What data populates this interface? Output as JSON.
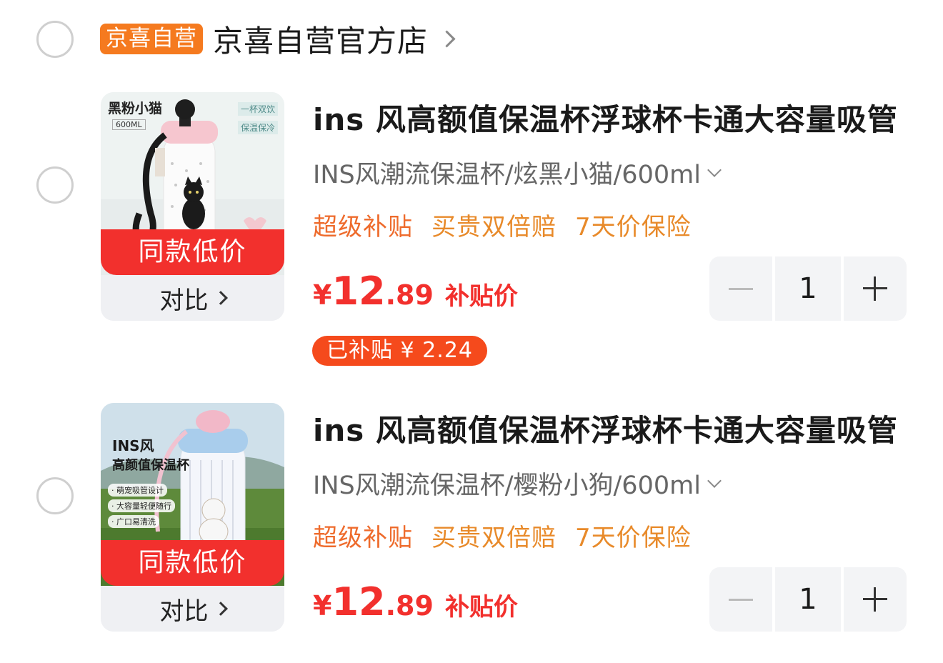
{
  "store": {
    "badge": "京喜自营",
    "name": "京喜自营官方店"
  },
  "items": [
    {
      "image_label": "黑粉小猫",
      "image_capacity": "600ML",
      "image_tag1": "一杯双饮",
      "image_tag2": "保温保冷",
      "same_price": "同款低价",
      "compare": "对比",
      "title": "ins 风高额值保温杯浮球杯卡通大容量吸管",
      "spec": "INS风潮流保温杯/炫黑小猫/600ml",
      "tags": [
        "超级补贴",
        "买贵双倍赔",
        "7天价保险"
      ],
      "price_currency": "¥",
      "price_int": "12",
      "price_dec": ".89",
      "price_label": "补贴价",
      "subsidy": "已补贴 ¥ 2.24",
      "qty": "1"
    },
    {
      "image_label": "INS风",
      "image_sub": "高颜值保温杯",
      "image_bullets": [
        "· 萌宠吸管设计",
        "· 大容量轻便随行",
        "· 广口易清洗"
      ],
      "same_price": "同款低价",
      "compare": "对比",
      "title": "ins 风高额值保温杯浮球杯卡通大容量吸管",
      "spec": "INS风潮流保温杯/樱粉小狗/600ml",
      "tags": [
        "超级补贴",
        "买贵双倍赔",
        "7天价保险"
      ],
      "price_currency": "¥",
      "price_int": "12",
      "price_dec": ".89",
      "price_label": "补贴价",
      "qty": "1"
    }
  ],
  "colors": {
    "accent_red": "#f2302d",
    "store_badge": "#f57a1f",
    "tag_orange": "#e88a2a"
  }
}
